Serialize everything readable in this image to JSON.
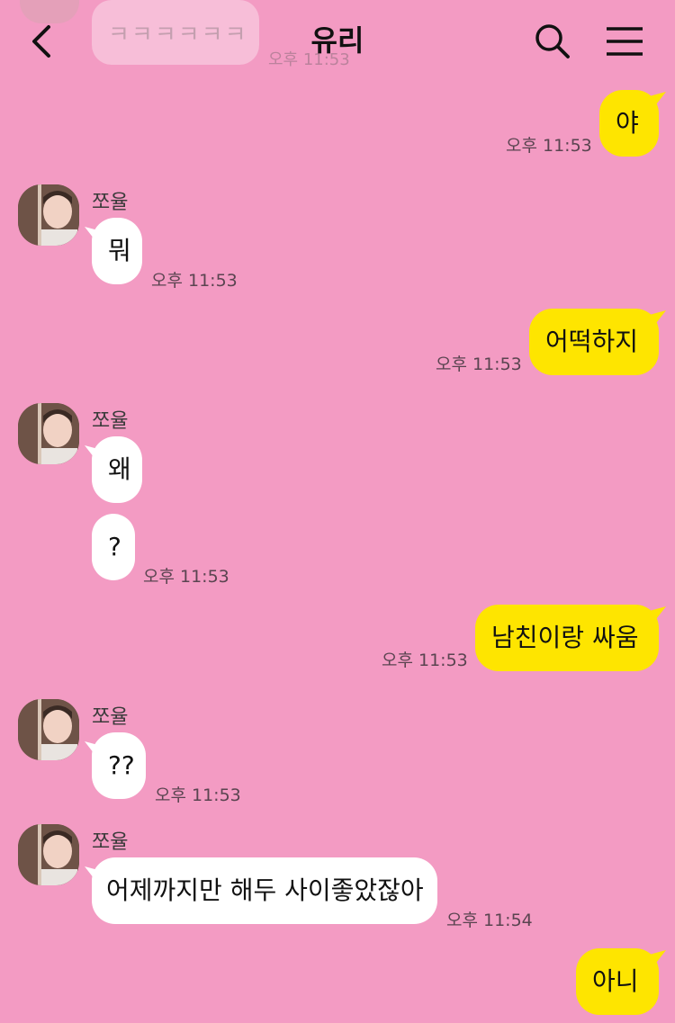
{
  "header": {
    "title": "유리"
  },
  "faded_message": {
    "text": "ㅋㅋㅋㅋㅋㅋ",
    "time": "오후 11:53"
  },
  "messages": [
    {
      "from": "me",
      "text": "야",
      "time": "오후 11:53"
    },
    {
      "from": "쪼율",
      "text": "뭐",
      "time": "오후 11:53"
    },
    {
      "from": "me",
      "text": "어떡하지",
      "time": "오후 11:53"
    },
    {
      "from": "쪼율",
      "text": "왜",
      "time": ""
    },
    {
      "from": "쪼율",
      "text": "?",
      "time": "오후 11:53"
    },
    {
      "from": "me",
      "text": "남친이랑 싸움",
      "time": "오후 11:53"
    },
    {
      "from": "쪼율",
      "text": "??",
      "time": "오후 11:53"
    },
    {
      "from": "쪼율",
      "text": "어제까지만 해두 사이좋았잖아",
      "time": "오후 11:54"
    },
    {
      "from": "me",
      "text": "아니",
      "time": ""
    }
  ],
  "sender_name": "쪼율",
  "colors": {
    "background": "#f39bc3",
    "incoming_bubble": "#ffffff",
    "outgoing_bubble": "#fee500"
  },
  "icons": {
    "back": "chevron-left-icon",
    "search": "search-icon",
    "menu": "hamburger-menu-icon"
  }
}
